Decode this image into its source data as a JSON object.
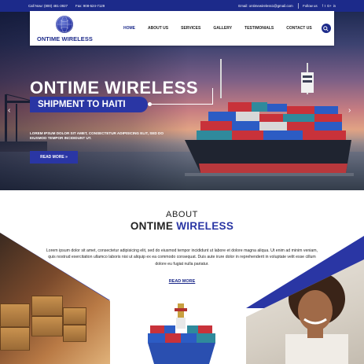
{
  "topbar": {
    "call": "Call Now: (800) 481-3927",
    "fax": "Fax: 908-524-7129",
    "email": "Email: ontimewireless1@gmail.com",
    "follow": "Follow us",
    "social_icons": [
      "facebook-icon",
      "twitter-icon",
      "google-plus-icon",
      "linkedin-icon"
    ],
    "social_glyphs": [
      "f",
      "t",
      "G+",
      "in"
    ]
  },
  "logo": {
    "text": "ONTIME WIRELESS"
  },
  "nav": {
    "items": [
      "HOME",
      "ABOUT US",
      "SERVICES",
      "GALLERY",
      "TESTIMONIALS",
      "CONTACT US"
    ],
    "active": "HOME"
  },
  "hero": {
    "title": "ONTIME WIRELESS",
    "subtitle": "SHIPMENT TO HAITI",
    "description": "LOREM IPSUM DOLOR SIT AMET, CONSECTETUR ADIPISICING ELIT, SED DO EIUSMOD TEMPOR INCIDIDUNT UT.",
    "button": "READ MORE »",
    "prev_arrow": "‹",
    "next_arrow": "›"
  },
  "about": {
    "kicker": "ABOUT",
    "title_main": "ONTIME ",
    "title_accent": "WIRELESS",
    "text": "Lorem ipsum dolor sit amet, consectetur adipisicing elit, sed do eiusmod tempor incididunt ut labore et dolore magna aliqua. Ut enim ad minim veniam, quis nostrud exercitation ullamco laboris nisi ut aliquip ex ea commodo consequat. Duis aute irure dolor in reprehenderit in voluptate velit esse cillum dolore eu fugiat nulla pariatur.",
    "read_more": "READ MORE"
  },
  "colors": {
    "brand": "#1c2a8a",
    "accent": "#2a36a4"
  }
}
